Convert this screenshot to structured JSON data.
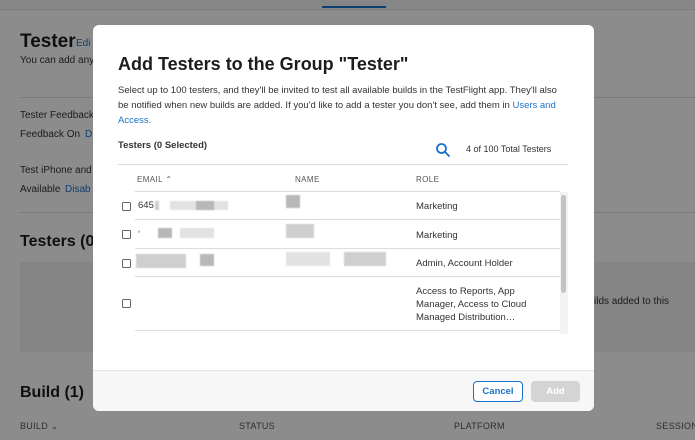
{
  "background": {
    "title": "Tester",
    "edit_link": "Edi",
    "description": "You can add any",
    "tester_feedback_label": "Tester Feedback",
    "feedback_on_label": "Feedback On",
    "feedback_link": "D",
    "test_iphone_label": "Test iPhone and",
    "available_label": "Available",
    "disable_link": "Disab",
    "testers_section": "Testers (0",
    "builds_note": "ilds added to this",
    "build_section": "Build (1)",
    "columns": {
      "build": "BUILD ⌄",
      "status": "STATUS",
      "platform": "PLATFORM",
      "session": "SESSION"
    }
  },
  "modal": {
    "title": "Add Testers to the Group \"Tester\"",
    "description": "Select up to 100 testers, and they'll be invited to test all available builds in the TestFlight app. They'll also be notified when new builds are added. If you'd like to add a tester you don't see, add them in",
    "description_link": "Users and Access.",
    "testers_label": "Testers (0 Selected)",
    "total_label": "4 of 100 Total Testers",
    "columns": {
      "email": "EMAIL ⌃",
      "name": "NAME",
      "role": "ROLE"
    },
    "rows": [
      {
        "email": "645",
        "role": "Marketing"
      },
      {
        "email": "‘",
        "role": "Marketing"
      },
      {
        "email": "",
        "role": "Admin, Account Holder"
      },
      {
        "email": "",
        "role": "Access to Reports, App Manager, Access to Cloud Managed Distribution…"
      }
    ],
    "cancel_label": "Cancel",
    "add_label": "Add"
  },
  "colors": {
    "accent": "#1a73c9",
    "overlay": "rgba(0,0,0,0.45)",
    "disabled_button": "#d4d4d4"
  },
  "icons": {
    "search": "search-icon",
    "sort": "chevron-up-icon"
  }
}
